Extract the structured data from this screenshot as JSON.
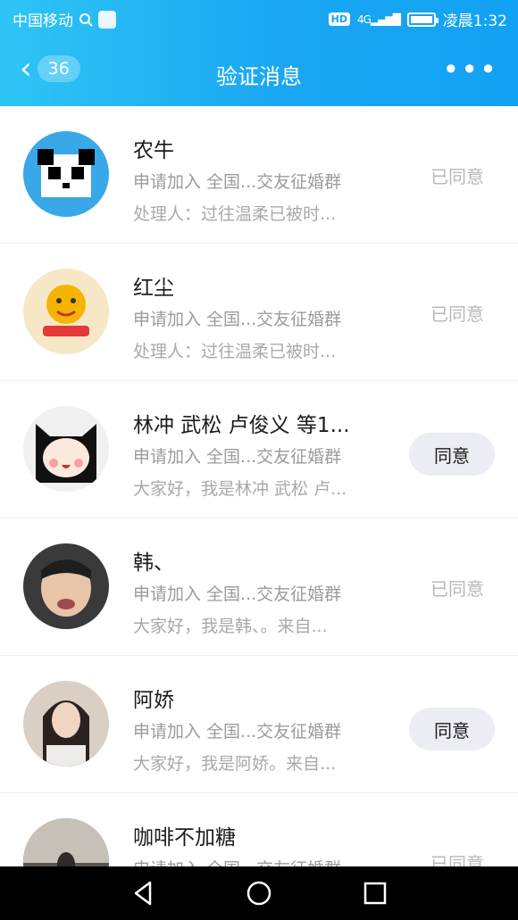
{
  "status_bar": {
    "carrier": "中国移动",
    "hd": "HD",
    "network": "4G",
    "time": "凌晨1:32",
    "battery_level": 0.9
  },
  "header": {
    "back_count": "36",
    "title": "验证消息",
    "more": "•••"
  },
  "requests": [
    {
      "name": "农牛",
      "group": "申请加入 全国...交友征婚群",
      "detail": "处理人：过往温柔已被时...",
      "state": "已同意",
      "pending": false,
      "avatar_bg": "#38a8e8"
    },
    {
      "name": "红尘",
      "group": "申请加入 全国...交友征婚群",
      "detail": "处理人：过往温柔已被时...",
      "state": "已同意",
      "pending": false,
      "avatar_bg": "#f6e8c6"
    },
    {
      "name": "林冲 武松 卢俊义 等1...",
      "group": "申请加入 全国...交友征婚群",
      "detail": "大家好，我是林冲 武松 卢...",
      "state": "同意",
      "pending": true,
      "avatar_bg": "#f0f0f0"
    },
    {
      "name": "韩、",
      "group": "申请加入 全国...交友征婚群",
      "detail": "大家好，我是韩、。来自...",
      "state": "已同意",
      "pending": false,
      "avatar_bg": "#3a3a3a"
    },
    {
      "name": "阿娇",
      "group": "申请加入 全国...交友征婚群",
      "detail": "大家好，我是阿娇。来自...",
      "state": "同意",
      "pending": true,
      "avatar_bg": "#d9cfc4"
    },
    {
      "name": "咖啡不加糖",
      "group": "申请加入 全国...交友征婚群",
      "detail": "",
      "state": "已同意",
      "pending": false,
      "avatar_bg": "#7a7470"
    }
  ],
  "colors": {
    "header_start": "#2ec5f5",
    "header_end": "#12a2f3",
    "muted_text": "#9b9b9b",
    "agree_button_bg": "#ecedf4"
  }
}
